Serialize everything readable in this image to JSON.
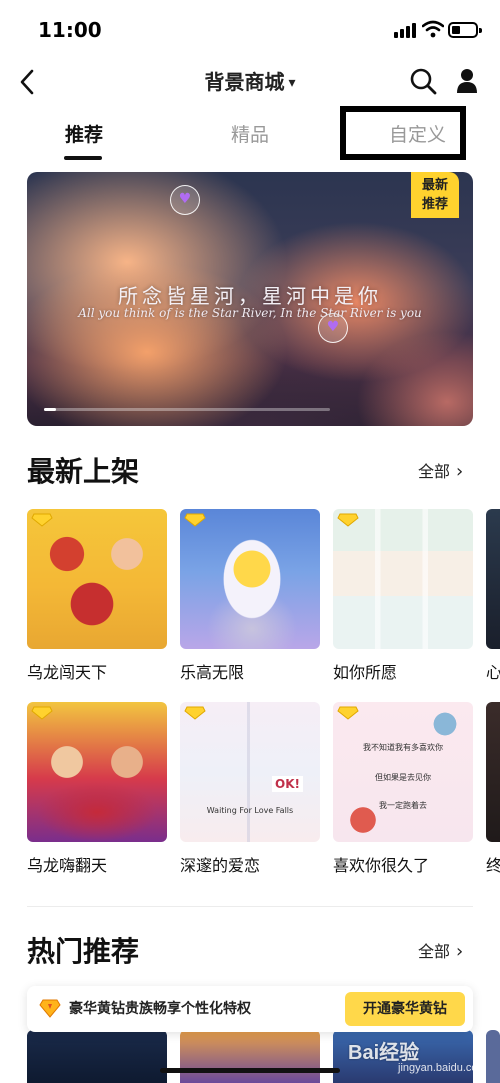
{
  "status_bar": {
    "time": "11:00"
  },
  "nav": {
    "title": "背景商城",
    "caret": "▾"
  },
  "tabs": [
    {
      "label": "推荐",
      "active": true
    },
    {
      "label": "精品",
      "active": false
    },
    {
      "label": "自定义",
      "active": false
    }
  ],
  "banner": {
    "badge_line1": "最新",
    "badge_line2": "推荐",
    "title": "所念皆星河，星河中是你",
    "subtitle": "All you think of is the Star River, In the Star River is you"
  },
  "section_new": {
    "title": "最新上架",
    "more": "全部",
    "row1": [
      {
        "label": "乌龙闯天下"
      },
      {
        "label": "乐高无限"
      },
      {
        "label": "如你所愿"
      },
      {
        "label": "心"
      }
    ],
    "row2": [
      {
        "label": "乌龙嗨翻天"
      },
      {
        "label": "深邃的爱恋"
      },
      {
        "label": "喜欢你很久了"
      },
      {
        "label": "终"
      }
    ],
    "card_texts": {
      "t6_caption": "Waiting For Love Falls",
      "t6_ok": "OK!",
      "t7_line1": "我不知道我有多喜欢你",
      "t7_line2": "但如果是去见你",
      "t7_line3": "我一定跑着去"
    }
  },
  "section_hot": {
    "title": "热门推荐",
    "more": "全部"
  },
  "vip": {
    "text": "豪华黄钻贵族畅享个性化特权",
    "button": "开通豪华黄钻"
  },
  "watermark": {
    "brand": "Bai经验",
    "url": "jingyan.baidu.com"
  },
  "colors": {
    "accent_yellow": "#ffd22e",
    "text_primary": "#111111",
    "text_muted": "#999999"
  }
}
